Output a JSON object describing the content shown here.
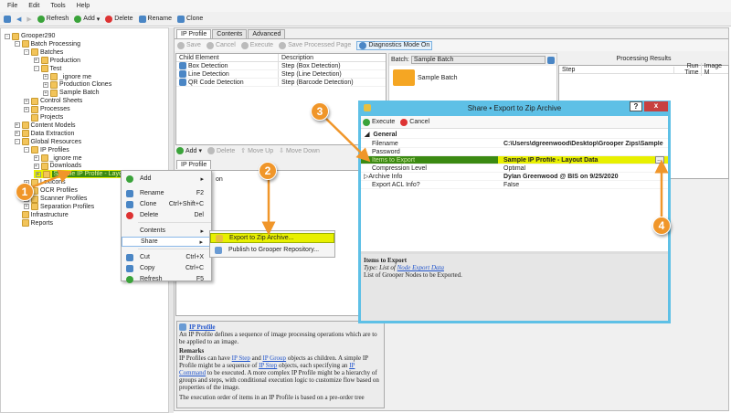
{
  "menubar": [
    "File",
    "Edit",
    "Tools",
    "Help"
  ],
  "toolbar": {
    "refresh": "Refresh",
    "add": "Add",
    "delete": "Delete",
    "rename": "Rename",
    "clone": "Clone"
  },
  "tree": [
    {
      "label": "Grooper290",
      "level": 0,
      "exp": "-"
    },
    {
      "label": "Batch Processing",
      "level": 1,
      "exp": "-"
    },
    {
      "label": "Batches",
      "level": 2,
      "exp": "-"
    },
    {
      "label": "Production",
      "level": 3,
      "exp": "+"
    },
    {
      "label": "Test",
      "level": 3,
      "exp": "-"
    },
    {
      "label": "_ignore me",
      "level": 4,
      "exp": "+"
    },
    {
      "label": "Production Clones",
      "level": 4,
      "exp": "+"
    },
    {
      "label": "Sample Batch",
      "level": 4,
      "exp": "+"
    },
    {
      "label": "Control Sheets",
      "level": 2,
      "exp": "+"
    },
    {
      "label": "Processes",
      "level": 2,
      "exp": "+"
    },
    {
      "label": "Projects",
      "level": 2,
      "exp": ""
    },
    {
      "label": "Content Models",
      "level": 1,
      "exp": "+"
    },
    {
      "label": "Data Extraction",
      "level": 1,
      "exp": "+"
    },
    {
      "label": "Global Resources",
      "level": 1,
      "exp": "-"
    },
    {
      "label": "IP Profiles",
      "level": 2,
      "exp": "-"
    },
    {
      "label": "_ignore me",
      "level": 3,
      "exp": "+"
    },
    {
      "label": "Downloads",
      "level": 3,
      "exp": "+"
    },
    {
      "label": "Sample IP Profile - Layout Data",
      "level": 3,
      "exp": "+",
      "selected": true
    },
    {
      "label": "Lexicons",
      "level": 2,
      "exp": "+"
    },
    {
      "label": "OCR Profiles",
      "level": 2,
      "exp": "+"
    },
    {
      "label": "Scanner Profiles",
      "level": 2,
      "exp": "+"
    },
    {
      "label": "Separation Profiles",
      "level": 2,
      "exp": "+"
    },
    {
      "label": "Infrastructure",
      "level": 1,
      "exp": ""
    },
    {
      "label": "Reports",
      "level": 1,
      "exp": ""
    }
  ],
  "tabs": [
    "IP Profile",
    "Contents",
    "Advanced"
  ],
  "ip_toolbar": {
    "save": "Save",
    "cancel": "Cancel",
    "execute": "Execute",
    "save_processed": "Save Processed Page",
    "diagnostics": "Diagnostics Mode On"
  },
  "child_grid": {
    "headers": [
      "Child Element",
      "Description"
    ],
    "rows": [
      [
        "Box Detection",
        "Step (Box Detection)"
      ],
      [
        "Line Detection",
        "Step (Line Detection)"
      ],
      [
        "QR Code Detection",
        "Step (Barcode Detection)"
      ]
    ]
  },
  "child_toolbar": {
    "add": "Add",
    "delete": "Delete",
    "move_up": "Move Up",
    "move_down": "Move Down"
  },
  "lower_tab": "IP Profile",
  "lower_fragment": "on",
  "help_pane": {
    "title": "IP Profile",
    "intro": "An IP Profile defines a sequence of image processing operations which are to be applied to an image.",
    "remarks": "Remarks",
    "p1a": "IP Profiles can have ",
    "link1": "IP Step",
    "p1b": " and ",
    "link2": "IP Group",
    "p1c": " objects as children. A simple IP Profile might be a sequence of ",
    "link3": "IP Step",
    "p1d": " objects, each specifying an ",
    "link4": "IP Command",
    "p1e": " to be executed. A more complex IP Profile might be a hierarchy of groups and steps, with conditional execution logic to customize flow based on properties of the image.",
    "p2": "The execution order of items in an IP Profile is based on a pre-order tree"
  },
  "batch": {
    "label": "Batch:",
    "value": "Sample Batch",
    "node": "Sample Batch"
  },
  "results": {
    "title": "Processing Results",
    "headers": [
      "Step",
      "Run Time",
      "Image M"
    ]
  },
  "context_menu": [
    {
      "label": "Add",
      "shortcut": "",
      "arrow": true,
      "icon": "add-icon"
    },
    {
      "label": "Rename",
      "shortcut": "F2",
      "icon": "rename-icon"
    },
    {
      "label": "Clone",
      "shortcut": "Ctrl+Shift+C",
      "icon": "clone-icon"
    },
    {
      "label": "Delete",
      "shortcut": "Del",
      "icon": "delete-icon"
    },
    {
      "label": "Contents",
      "shortcut": "",
      "arrow": true,
      "icon": ""
    },
    {
      "label": "Share",
      "shortcut": "",
      "arrow": true,
      "icon": "",
      "highlight": true
    },
    {
      "label": "Cut",
      "shortcut": "Ctrl+X",
      "icon": "cut-icon"
    },
    {
      "label": "Copy",
      "shortcut": "Ctrl+C",
      "icon": "copy-icon"
    },
    {
      "label": "Refresh",
      "shortcut": "F5",
      "icon": "refresh-icon"
    }
  ],
  "share_menu": [
    {
      "label": "Export to Zip Archive...",
      "highlight": true
    },
    {
      "label": "Publish to Grooper Repository..."
    }
  ],
  "dialog": {
    "title": "Share • Export to Zip Archive",
    "help": "?",
    "close": "x",
    "execute": "Execute",
    "cancel": "Cancel",
    "category": "General",
    "props": [
      {
        "key": "Filename",
        "value": "C:\\Users\\dgreenwood\\Desktop\\Grooper Zips\\Sample",
        "bold": true
      },
      {
        "key": "Password",
        "value": ""
      },
      {
        "key": "Items to Export",
        "value": "Sample IP Profile - Layout Data",
        "bold": true,
        "selected": true
      },
      {
        "key": "Compression Level",
        "value": "Optimal"
      },
      {
        "key": "Archive Info",
        "value": "Dylan Greenwood @ BIS on 9/25/2020",
        "bold": true,
        "expand": true
      },
      {
        "key": "Export ACL Info?",
        "value": "False"
      }
    ],
    "ellipsis": "...",
    "help_title": "Items to Export",
    "help_type": "Type: List of ",
    "help_type_link": "Node Export Data",
    "help_desc": "List of Grooper Nodes to be Exported."
  },
  "badges": [
    "1",
    "2",
    "3",
    "4"
  ],
  "colors": {
    "highlight": "#e8f000",
    "selection": "#3b8a12",
    "callout": "#f0962a",
    "dialog_frame": "#5ec0e6"
  }
}
